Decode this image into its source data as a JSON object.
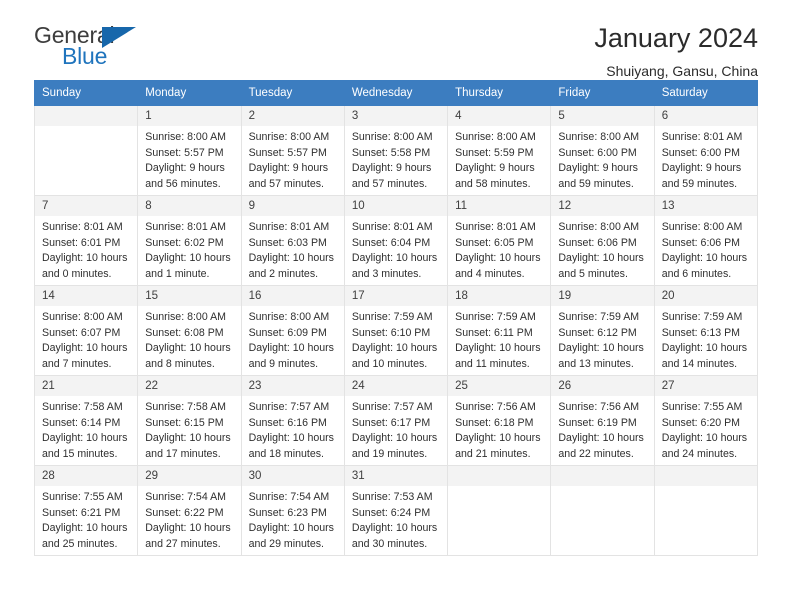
{
  "logo": {
    "word1": "General",
    "word2": "Blue",
    "triangle_color": "#1767ab"
  },
  "header": {
    "title": "January 2024",
    "subtitle": "Shuiyang, Gansu, China"
  },
  "theme": {
    "header_bg": "#3c7dc0",
    "header_text": "#ffffff",
    "daynum_bg": "#f3f3f3",
    "grid_border": "#e3e3e3"
  },
  "weekdays": [
    "Sunday",
    "Monday",
    "Tuesday",
    "Wednesday",
    "Thursday",
    "Friday",
    "Saturday"
  ],
  "weeks": [
    [
      {
        "day": "",
        "sunrise": "",
        "sunset": "",
        "daylight1": "",
        "daylight2": ""
      },
      {
        "day": "1",
        "sunrise": "Sunrise: 8:00 AM",
        "sunset": "Sunset: 5:57 PM",
        "daylight1": "Daylight: 9 hours",
        "daylight2": "and 56 minutes."
      },
      {
        "day": "2",
        "sunrise": "Sunrise: 8:00 AM",
        "sunset": "Sunset: 5:57 PM",
        "daylight1": "Daylight: 9 hours",
        "daylight2": "and 57 minutes."
      },
      {
        "day": "3",
        "sunrise": "Sunrise: 8:00 AM",
        "sunset": "Sunset: 5:58 PM",
        "daylight1": "Daylight: 9 hours",
        "daylight2": "and 57 minutes."
      },
      {
        "day": "4",
        "sunrise": "Sunrise: 8:00 AM",
        "sunset": "Sunset: 5:59 PM",
        "daylight1": "Daylight: 9 hours",
        "daylight2": "and 58 minutes."
      },
      {
        "day": "5",
        "sunrise": "Sunrise: 8:00 AM",
        "sunset": "Sunset: 6:00 PM",
        "daylight1": "Daylight: 9 hours",
        "daylight2": "and 59 minutes."
      },
      {
        "day": "6",
        "sunrise": "Sunrise: 8:01 AM",
        "sunset": "Sunset: 6:00 PM",
        "daylight1": "Daylight: 9 hours",
        "daylight2": "and 59 minutes."
      }
    ],
    [
      {
        "day": "7",
        "sunrise": "Sunrise: 8:01 AM",
        "sunset": "Sunset: 6:01 PM",
        "daylight1": "Daylight: 10 hours",
        "daylight2": "and 0 minutes."
      },
      {
        "day": "8",
        "sunrise": "Sunrise: 8:01 AM",
        "sunset": "Sunset: 6:02 PM",
        "daylight1": "Daylight: 10 hours",
        "daylight2": "and 1 minute."
      },
      {
        "day": "9",
        "sunrise": "Sunrise: 8:01 AM",
        "sunset": "Sunset: 6:03 PM",
        "daylight1": "Daylight: 10 hours",
        "daylight2": "and 2 minutes."
      },
      {
        "day": "10",
        "sunrise": "Sunrise: 8:01 AM",
        "sunset": "Sunset: 6:04 PM",
        "daylight1": "Daylight: 10 hours",
        "daylight2": "and 3 minutes."
      },
      {
        "day": "11",
        "sunrise": "Sunrise: 8:01 AM",
        "sunset": "Sunset: 6:05 PM",
        "daylight1": "Daylight: 10 hours",
        "daylight2": "and 4 minutes."
      },
      {
        "day": "12",
        "sunrise": "Sunrise: 8:00 AM",
        "sunset": "Sunset: 6:06 PM",
        "daylight1": "Daylight: 10 hours",
        "daylight2": "and 5 minutes."
      },
      {
        "day": "13",
        "sunrise": "Sunrise: 8:00 AM",
        "sunset": "Sunset: 6:06 PM",
        "daylight1": "Daylight: 10 hours",
        "daylight2": "and 6 minutes."
      }
    ],
    [
      {
        "day": "14",
        "sunrise": "Sunrise: 8:00 AM",
        "sunset": "Sunset: 6:07 PM",
        "daylight1": "Daylight: 10 hours",
        "daylight2": "and 7 minutes."
      },
      {
        "day": "15",
        "sunrise": "Sunrise: 8:00 AM",
        "sunset": "Sunset: 6:08 PM",
        "daylight1": "Daylight: 10 hours",
        "daylight2": "and 8 minutes."
      },
      {
        "day": "16",
        "sunrise": "Sunrise: 8:00 AM",
        "sunset": "Sunset: 6:09 PM",
        "daylight1": "Daylight: 10 hours",
        "daylight2": "and 9 minutes."
      },
      {
        "day": "17",
        "sunrise": "Sunrise: 7:59 AM",
        "sunset": "Sunset: 6:10 PM",
        "daylight1": "Daylight: 10 hours",
        "daylight2": "and 10 minutes."
      },
      {
        "day": "18",
        "sunrise": "Sunrise: 7:59 AM",
        "sunset": "Sunset: 6:11 PM",
        "daylight1": "Daylight: 10 hours",
        "daylight2": "and 11 minutes."
      },
      {
        "day": "19",
        "sunrise": "Sunrise: 7:59 AM",
        "sunset": "Sunset: 6:12 PM",
        "daylight1": "Daylight: 10 hours",
        "daylight2": "and 13 minutes."
      },
      {
        "day": "20",
        "sunrise": "Sunrise: 7:59 AM",
        "sunset": "Sunset: 6:13 PM",
        "daylight1": "Daylight: 10 hours",
        "daylight2": "and 14 minutes."
      }
    ],
    [
      {
        "day": "21",
        "sunrise": "Sunrise: 7:58 AM",
        "sunset": "Sunset: 6:14 PM",
        "daylight1": "Daylight: 10 hours",
        "daylight2": "and 15 minutes."
      },
      {
        "day": "22",
        "sunrise": "Sunrise: 7:58 AM",
        "sunset": "Sunset: 6:15 PM",
        "daylight1": "Daylight: 10 hours",
        "daylight2": "and 17 minutes."
      },
      {
        "day": "23",
        "sunrise": "Sunrise: 7:57 AM",
        "sunset": "Sunset: 6:16 PM",
        "daylight1": "Daylight: 10 hours",
        "daylight2": "and 18 minutes."
      },
      {
        "day": "24",
        "sunrise": "Sunrise: 7:57 AM",
        "sunset": "Sunset: 6:17 PM",
        "daylight1": "Daylight: 10 hours",
        "daylight2": "and 19 minutes."
      },
      {
        "day": "25",
        "sunrise": "Sunrise: 7:56 AM",
        "sunset": "Sunset: 6:18 PM",
        "daylight1": "Daylight: 10 hours",
        "daylight2": "and 21 minutes."
      },
      {
        "day": "26",
        "sunrise": "Sunrise: 7:56 AM",
        "sunset": "Sunset: 6:19 PM",
        "daylight1": "Daylight: 10 hours",
        "daylight2": "and 22 minutes."
      },
      {
        "day": "27",
        "sunrise": "Sunrise: 7:55 AM",
        "sunset": "Sunset: 6:20 PM",
        "daylight1": "Daylight: 10 hours",
        "daylight2": "and 24 minutes."
      }
    ],
    [
      {
        "day": "28",
        "sunrise": "Sunrise: 7:55 AM",
        "sunset": "Sunset: 6:21 PM",
        "daylight1": "Daylight: 10 hours",
        "daylight2": "and 25 minutes."
      },
      {
        "day": "29",
        "sunrise": "Sunrise: 7:54 AM",
        "sunset": "Sunset: 6:22 PM",
        "daylight1": "Daylight: 10 hours",
        "daylight2": "and 27 minutes."
      },
      {
        "day": "30",
        "sunrise": "Sunrise: 7:54 AM",
        "sunset": "Sunset: 6:23 PM",
        "daylight1": "Daylight: 10 hours",
        "daylight2": "and 29 minutes."
      },
      {
        "day": "31",
        "sunrise": "Sunrise: 7:53 AM",
        "sunset": "Sunset: 6:24 PM",
        "daylight1": "Daylight: 10 hours",
        "daylight2": "and 30 minutes."
      },
      {
        "day": "",
        "sunrise": "",
        "sunset": "",
        "daylight1": "",
        "daylight2": ""
      },
      {
        "day": "",
        "sunrise": "",
        "sunset": "",
        "daylight1": "",
        "daylight2": ""
      },
      {
        "day": "",
        "sunrise": "",
        "sunset": "",
        "daylight1": "",
        "daylight2": ""
      }
    ]
  ]
}
